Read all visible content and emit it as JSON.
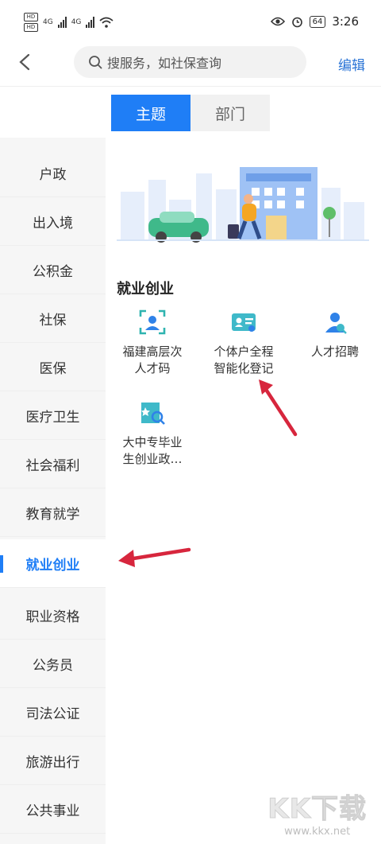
{
  "status_bar": {
    "left_badge_top": "HD",
    "left_badge_bottom": "HD",
    "sig1": "4G",
    "sig2": "4G",
    "battery": "64",
    "time": "3:26"
  },
  "header": {
    "search_placeholder": "搜服务，如社保查询",
    "edit_label": "编辑"
  },
  "tabs": [
    {
      "label": "主题"
    },
    {
      "label": "部门"
    }
  ],
  "sidebar": {
    "items": [
      {
        "label": "户政"
      },
      {
        "label": "出入境"
      },
      {
        "label": "公积金"
      },
      {
        "label": "社保"
      },
      {
        "label": "医保"
      },
      {
        "label": "医疗卫生"
      },
      {
        "label": "社会福利"
      },
      {
        "label": "教育就学"
      },
      {
        "label": "就业创业"
      },
      {
        "label": "职业资格"
      },
      {
        "label": "公务员"
      },
      {
        "label": "司法公证"
      },
      {
        "label": "旅游出行"
      },
      {
        "label": "公共事业"
      }
    ],
    "active_index": 8
  },
  "section": {
    "title": "就业创业"
  },
  "services": [
    {
      "line1": "福建高层次",
      "line2": "人才码"
    },
    {
      "line1": "个体户全程",
      "line2": "智能化登记"
    },
    {
      "line1": "人才招聘",
      "line2": ""
    },
    {
      "line1": "大中专毕业",
      "line2": "生创业政…"
    }
  ],
  "watermark": {
    "main": "KK下载",
    "sub": "www.kkx.net"
  },
  "colors": {
    "accent": "#1f7ef6",
    "annotation_arrow": "#d7263d"
  }
}
